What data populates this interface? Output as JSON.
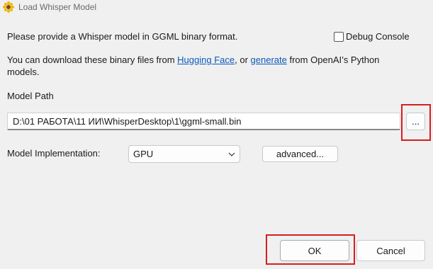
{
  "window": {
    "title": "Load Whisper Model",
    "icon": "sunflower-icon"
  },
  "intro": {
    "text": "Please provide a Whisper model in GGML binary format."
  },
  "debug_console": {
    "label": "Debug Console",
    "checked": false
  },
  "download_info": {
    "prefix": "You can download these binary files from ",
    "link1": "Hugging Face",
    "middle": ", or ",
    "link2": "generate",
    "suffix": " from OpenAI’s Python",
    "line2": "models."
  },
  "model_path": {
    "label": "Model Path",
    "value": "D:\\01 РАБОТА\\11 ИИ\\WhisperDesktop\\1\\ggml-small.bin",
    "browse_label": "..."
  },
  "implementation": {
    "label": "Model Implementation:",
    "selected": "GPU",
    "advanced_label": "advanced..."
  },
  "buttons": {
    "ok": "OK",
    "cancel": "Cancel"
  },
  "colors": {
    "highlight": "#d61e1e",
    "link": "#0a59b8"
  }
}
